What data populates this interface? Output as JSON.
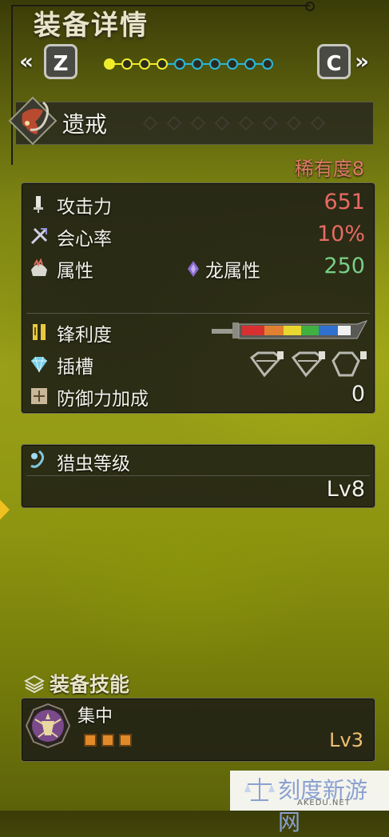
{
  "header": {
    "title": "装备详情",
    "prev_key": "Z",
    "next_key": "C",
    "prev_arrows": "«",
    "next_arrows": "»",
    "page_dots": {
      "total": 10,
      "active_index": 0,
      "yellow_count": 4
    }
  },
  "weapon": {
    "name": "遗戒",
    "rarity": "稀有度8"
  },
  "stats": {
    "attack_label": "攻击力",
    "attack_value": "651",
    "affinity_label": "会心率",
    "affinity_value": "10%",
    "element_label": "属性",
    "element_type": "龙属性",
    "element_value": "250",
    "sharpness_label": "锋利度",
    "slots_label": "插槽",
    "defense_label": "防御力加成",
    "defense_value": "0"
  },
  "kinsect": {
    "label": "猎虫等级",
    "level": "Lv8"
  },
  "skills": {
    "section_title": "装备技能",
    "items": [
      {
        "name": "集中",
        "level": "Lv3",
        "pips": 3
      }
    ]
  },
  "watermark": {
    "main": "刻度新游网",
    "sub": "AKEDU.NET"
  },
  "colors": {
    "accent_red": "#e86a64",
    "accent_green": "#78d088",
    "dot_yellow": "#f0ec2a",
    "dot_cyan": "#2ab8d8",
    "rarity": "#e07a6a"
  },
  "icons": [
    "sword-icon",
    "crit-icon",
    "element-icon",
    "dragon-icon",
    "sharpness-icon",
    "gem-icon",
    "shield-icon",
    "kinsect-icon",
    "skills-icon",
    "skill-badge-icon"
  ]
}
